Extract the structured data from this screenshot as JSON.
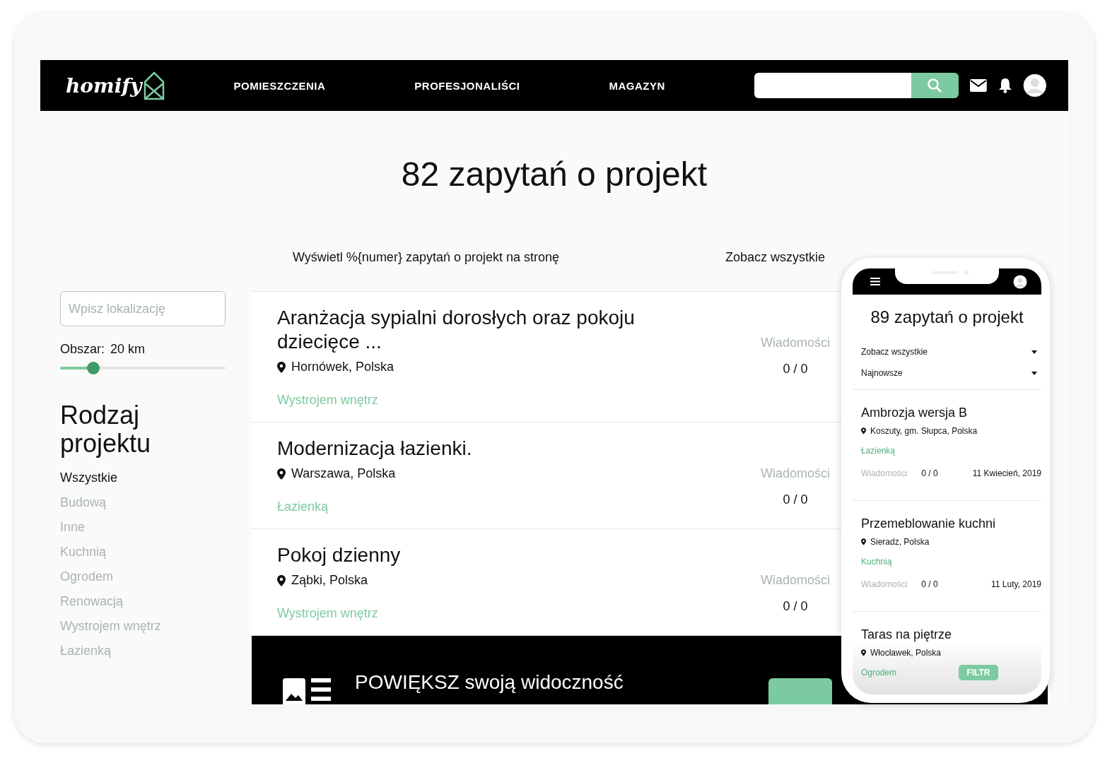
{
  "header": {
    "logo": "homify",
    "nav": [
      {
        "label": "POMIESZCZENIA"
      },
      {
        "label": "PROFESJONALIŚCI"
      },
      {
        "label": "MAGAZYN"
      }
    ]
  },
  "title": "82 zapytań o projekt",
  "toolbar": {
    "per_page": "Wyświetl %{numer} zapytań o projekt na stronę",
    "filter": "Zobacz wszystkie"
  },
  "sidebar": {
    "location": {
      "placeholder": "Wpisz lokalizację"
    },
    "area_label": "Obszar:",
    "area_value": "20 km",
    "area": {
      "level": 0.2
    },
    "heading": "Rodzaj projektu",
    "types": [
      {
        "label": "Wszystkie",
        "selected": true
      },
      {
        "label": "Budową",
        "selected": false
      },
      {
        "label": "Inne",
        "selected": false
      },
      {
        "label": "Kuchnią",
        "selected": false
      },
      {
        "label": "Ogrodem",
        "selected": false
      },
      {
        "label": "Renowacją",
        "selected": false
      },
      {
        "label": "Wystrojem wnętrz",
        "selected": false
      },
      {
        "label": "Łazienką",
        "selected": false
      }
    ]
  },
  "projects": [
    {
      "title": "Aranżacja sypialni dorosłych oraz pokoju dziecięce ...",
      "location": "Hornówek, Polska",
      "tag": "Wystrojem wnętrz",
      "messages_label": "Wiadomości",
      "messages": "0 / 0"
    },
    {
      "title": "Modernizacja łazienki.",
      "location": "Warszawa, Polska",
      "tag": "Łazienką",
      "messages_label": "Wiadomości",
      "messages": "0 / 0"
    },
    {
      "title": "Pokoj dzienny",
      "location": "Ząbki, Polska",
      "tag": "Wystrojem wnętrz",
      "messages_label": "Wiadomości",
      "messages": "0 / 0"
    }
  ],
  "banner": {
    "title": "POWIĘKSZ swoją widoczność"
  },
  "phone": {
    "title": "89 zapytań o projekt",
    "dropdowns": [
      {
        "label": "Zobacz wszystkie"
      },
      {
        "label": "Najnowsze"
      }
    ],
    "projects": [
      {
        "title": "Ambrozja wersja B",
        "location": "Koszuty, gm. Słupca, Polska",
        "tag": "Łazienką",
        "messages_label": "Wiadomości",
        "messages": "0 / 0",
        "date": "11 Kwiecień, 2019"
      },
      {
        "title": "Przemeblowanie kuchni",
        "location": "Sieradz, Polska",
        "tag": "Kuchnią",
        "messages_label": "Wiadomości",
        "messages": "0 / 0",
        "date": "11 Luty, 2019"
      },
      {
        "title": "Taras na piętrze",
        "location": "Włocławek, Polska",
        "tag": "Ogrodem"
      }
    ],
    "filter_button": "FILTR"
  }
}
